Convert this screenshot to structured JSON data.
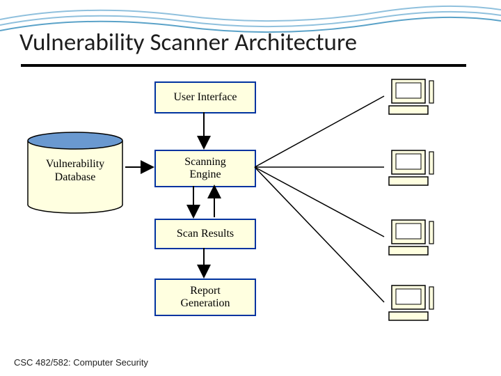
{
  "title": "Vulnerability Scanner Architecture",
  "nodes": {
    "user_interface": "User Interface",
    "db_line1": "Vulnerability",
    "db_line2": "Database",
    "scanning_line1": "Scanning",
    "scanning_line2": "Engine",
    "scan_results": "Scan Results",
    "report_line1": "Report",
    "report_line2": "Generation"
  },
  "footer": "CSC 482/582: Computer Security",
  "colors": {
    "box_border": "#0033a0",
    "box_fill": "#ffffe0",
    "db_top": "#6a99d0",
    "db_outline": "#000000"
  }
}
